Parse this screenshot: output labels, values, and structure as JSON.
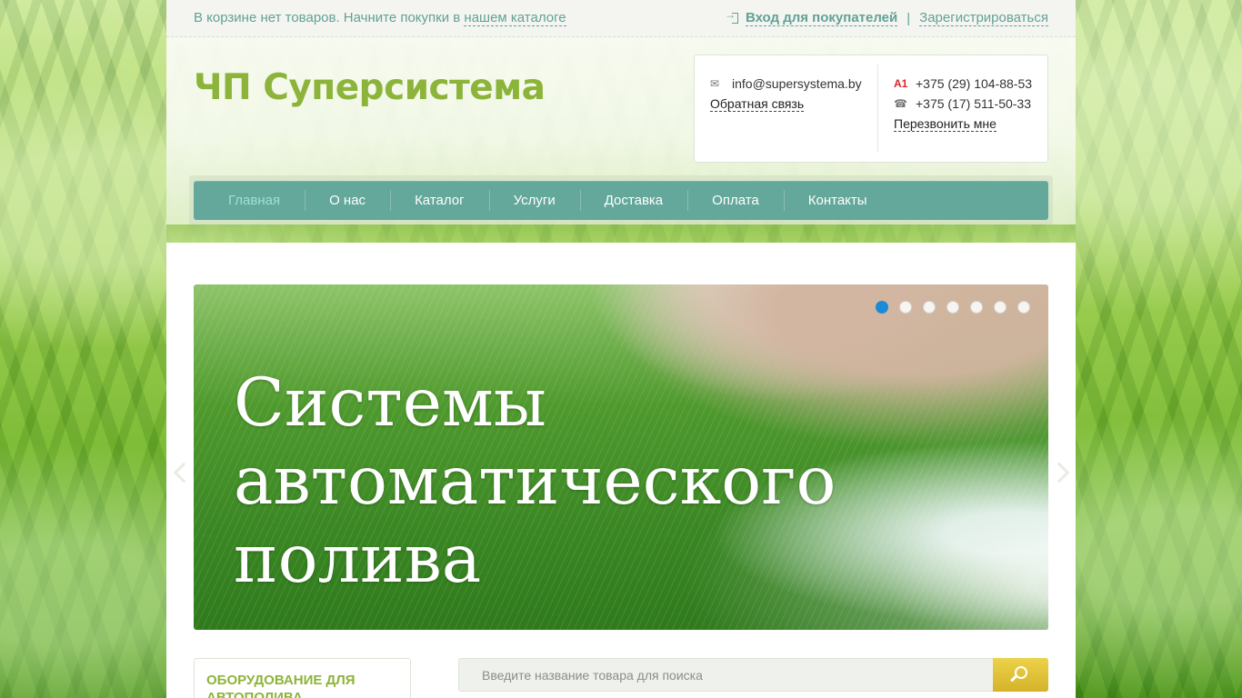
{
  "topbar": {
    "cart_text": "В корзине нет товаров. Начните покупки в",
    "catalog_link": "нашем каталоге",
    "login_label": "Вход для покупателей",
    "separator": "|",
    "register_label": "Зарегистрироваться"
  },
  "logo": {
    "text": "ЧП Суперсистема"
  },
  "contacts": {
    "email": "info@supersystema.by",
    "feedback_link": "Обратная связь",
    "phone_mobile": "+375 (29) 104-88-53",
    "phone_landline": "+375 (17) 511-50-33",
    "callback_link": "Перезвонить мне",
    "mobile_operator_icon": "A1"
  },
  "nav": {
    "items": [
      "Главная",
      "О нас",
      "Каталог",
      "Услуги",
      "Доставка",
      "Оплата",
      "Контакты"
    ],
    "active": "Главная"
  },
  "slider": {
    "headline_line1": "Системы",
    "headline_line2": "автоматического",
    "headline_line3": "полива",
    "slide_count": 7,
    "active_slide": 1
  },
  "sidebar": {
    "category_title": "ОБОРУДОВАНИЕ ДЛЯ АВТОПОЛИВА"
  },
  "search": {
    "placeholder": "Введите название товара для поиска"
  },
  "colors": {
    "accent_teal": "#63a89a",
    "logo_green": "#8db43a",
    "search_button": "#d4b32a",
    "active_dot": "#1a8bd6"
  }
}
